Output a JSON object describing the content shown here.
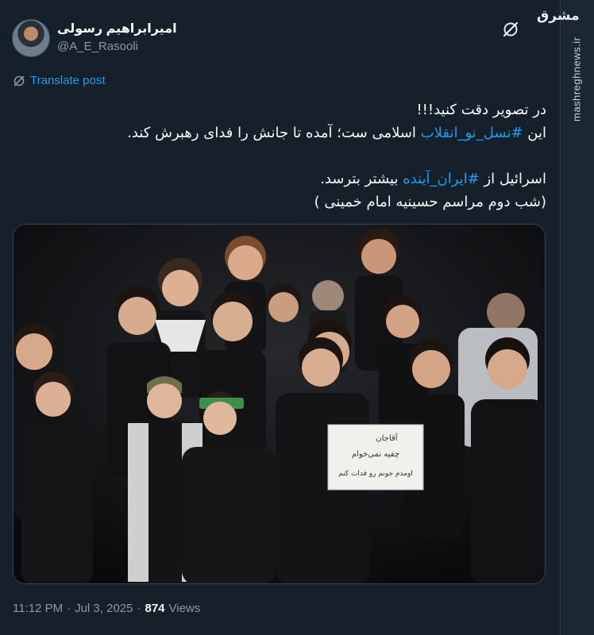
{
  "author": {
    "name": "امیرابراهیم رسولی",
    "handle": "@A_E_Rasooli"
  },
  "translate_label": "Translate post",
  "watermark": {
    "logo_text": "مشرق",
    "site": "mashreghnews.ir"
  },
  "tweet": {
    "line1": "در تصویر دقت کنید!!!",
    "line2_prefix": "این ",
    "line2_hashtag": "#نسل_نو_انقلاب",
    "line2_suffix": " اسلامی ست؛ آمده تا جانش را فدای رهبرش کند.",
    "line3_prefix": "اسرائیل از ",
    "line3_hashtag": "#ایران_آینده",
    "line3_suffix": " بیشتر بترسد.",
    "line4": "(شب دوم مراسم حسینیه امام خمینی )"
  },
  "photo": {
    "sign_lines": [
      "آقاجان",
      "چفیه نمی‌خوام",
      "اومدم جونم رو فدات کنم"
    ]
  },
  "meta": {
    "time": "11:12 PM",
    "separator1": "·",
    "date": "Jul 3, 2025",
    "separator2": "·",
    "views_count": "874",
    "views_label": "Views"
  },
  "colors": {
    "background": "#15202b",
    "link": "#1d9bf0",
    "muted": "#8b98a5",
    "text": "#f7f9f9"
  },
  "icons": {
    "grok": "grok-slash-circle-icon",
    "translate": "translate-slash-icon"
  }
}
